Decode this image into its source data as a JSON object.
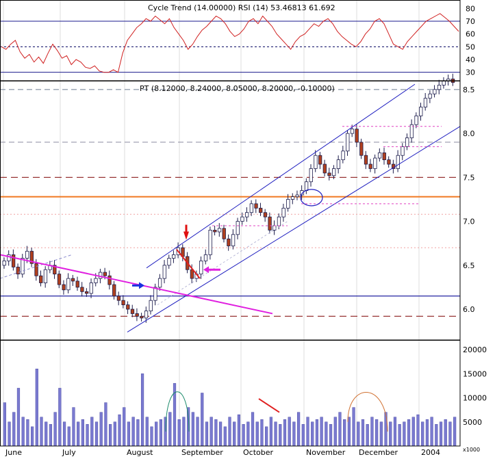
{
  "chart_data": [
    {
      "type": "line",
      "panel": "oscillator",
      "title": "Cycle Trend (14.00000) RSI (14) 53.46813 61.692",
      "y_ticks": [
        "80",
        "70",
        "60",
        "50",
        "40",
        "30"
      ],
      "ylim": [
        25,
        85
      ],
      "reference_lines": [
        70,
        50,
        30
      ],
      "series": [
        {
          "values": [
            50,
            48,
            52,
            55,
            46,
            41,
            44,
            38,
            42,
            37,
            45,
            52,
            47,
            41,
            43,
            36,
            40,
            38,
            34,
            33,
            35,
            31,
            30,
            30,
            32,
            30,
            45,
            55,
            60,
            65,
            68,
            72,
            70,
            74,
            71,
            68,
            72,
            65,
            60,
            55,
            48,
            52,
            58,
            63,
            66,
            70,
            74,
            72,
            68,
            62,
            58,
            60,
            64,
            70,
            72,
            68,
            74,
            70,
            66,
            60,
            56,
            52,
            48,
            54,
            58,
            60,
            64,
            68,
            66,
            70,
            72,
            68,
            62,
            58,
            55,
            52,
            50,
            54,
            60,
            64,
            70,
            72,
            68,
            60,
            52,
            50,
            48,
            54,
            58,
            62,
            66,
            70,
            72,
            74,
            76,
            73,
            70,
            66,
            62
          ]
        }
      ]
    },
    {
      "type": "candlestick",
      "panel": "price",
      "title": "PT (8.12000, 8.24000, 8.05000, 8.20000, -0.10000)",
      "y_ticks": [
        "8.5",
        "8.0",
        "7.5",
        "7.0",
        "6.5",
        "6.0"
      ],
      "ylim": [
        5.65,
        8.6
      ],
      "x_ticks": [
        "June",
        "July",
        "August",
        "September",
        "October",
        "November",
        "December",
        "2004"
      ],
      "horizontal_levels": {
        "solid_orange": [
          7.28
        ],
        "solid_blue": [
          6.15
        ],
        "dashed_dark_red": [
          7.5,
          5.92
        ],
        "dashed_steel": [
          8.5
        ]
      },
      "closes": [
        6.55,
        6.62,
        6.48,
        6.4,
        6.58,
        6.66,
        6.52,
        6.38,
        6.3,
        6.45,
        6.5,
        6.4,
        6.28,
        6.22,
        6.35,
        6.32,
        6.25,
        6.2,
        6.18,
        6.3,
        6.35,
        6.42,
        6.38,
        6.28,
        6.15,
        6.1,
        6.05,
        6.0,
        5.95,
        5.92,
        5.9,
        5.98,
        6.1,
        6.25,
        6.35,
        6.5,
        6.58,
        6.62,
        6.7,
        6.6,
        6.45,
        6.35,
        6.4,
        6.55,
        6.62,
        6.9,
        6.88,
        6.92,
        6.8,
        6.72,
        6.85,
        7.0,
        7.05,
        7.1,
        7.2,
        7.15,
        7.1,
        7.05,
        6.9,
        6.95,
        7.05,
        7.15,
        7.25,
        7.28,
        7.3,
        7.35,
        7.45,
        7.6,
        7.75,
        7.65,
        7.55,
        7.52,
        7.6,
        7.7,
        7.8,
        8.0,
        8.05,
        7.9,
        7.75,
        7.65,
        7.6,
        7.72,
        7.78,
        7.7,
        7.65,
        7.6,
        7.75,
        7.85,
        7.95,
        8.1,
        8.2,
        8.3,
        8.4,
        8.45,
        8.5,
        8.55,
        8.6,
        8.62,
        8.58
      ]
    },
    {
      "type": "bar",
      "panel": "volume",
      "y_ticks": [
        "20000",
        "15000",
        "10000",
        "5000"
      ],
      "ylim": [
        0,
        22000
      ],
      "unit_label": "x1000",
      "values": [
        9000,
        5000,
        7000,
        12000,
        6000,
        5500,
        4000,
        16000,
        6000,
        5000,
        4500,
        7000,
        12000,
        5000,
        4000,
        8000,
        5000,
        5500,
        4500,
        6000,
        5000,
        7000,
        9000,
        4500,
        5000,
        6500,
        8000,
        5000,
        6000,
        5500,
        15000,
        6000,
        4000,
        5000,
        5500,
        6000,
        7000,
        13000,
        5500,
        6000,
        8000,
        7000,
        6000,
        11000,
        5000,
        6000,
        5500,
        5000,
        4000,
        6000,
        5000,
        6500,
        4500,
        5000,
        7000,
        5000,
        5500,
        4000,
        6000,
        5000,
        4500,
        5500,
        6000,
        5000,
        7000,
        4500,
        6000,
        5000,
        5500,
        6000,
        5000,
        4500,
        6000,
        7000,
        5500,
        6000,
        8000,
        5000,
        5500,
        4500,
        6000,
        5500,
        5000,
        7000,
        5000,
        6000,
        4500,
        5000,
        5500,
        6000,
        6500,
        5000,
        5500,
        6000,
        4500,
        5000,
        5500,
        5000,
        6000
      ]
    }
  ]
}
